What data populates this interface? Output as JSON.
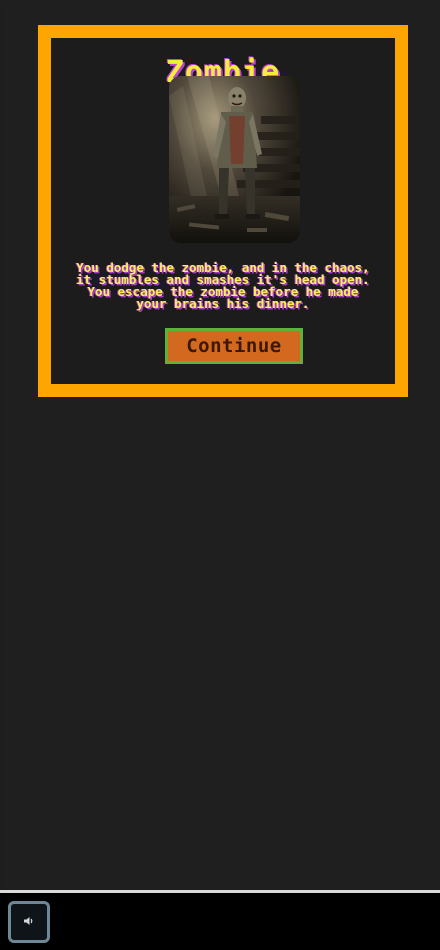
{
  "scene": {
    "title": "Zombie",
    "image_subject": "zombie-portrait",
    "story": "You dodge the zombie, and in the chaos, it stumbles and smashes it's head open. You escape the zombie before he made your brains his dinner.",
    "continue_label": "Continue"
  },
  "controls": {
    "sound_icon": "speaker-icon"
  },
  "colors": {
    "card_border": "#ffa500",
    "title_text": "#f2ee3a",
    "text_shadow": "#c040d8",
    "button_bg": "#d2691e",
    "button_border": "#5fb13a"
  }
}
